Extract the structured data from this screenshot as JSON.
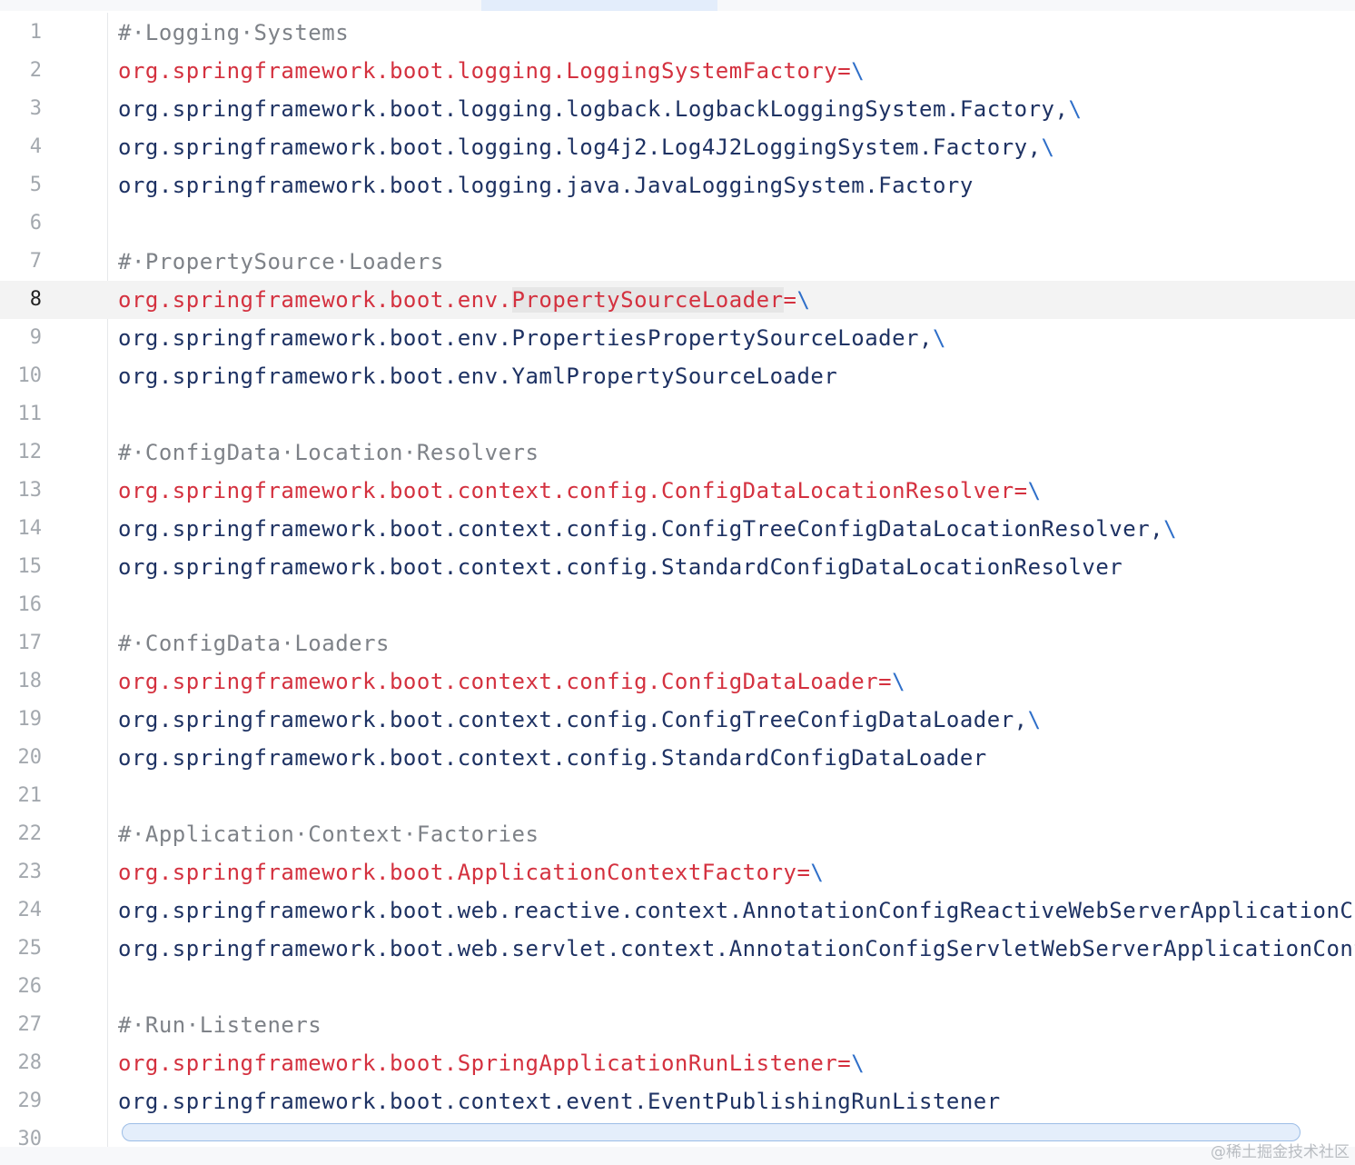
{
  "editor": {
    "current_line": 8,
    "lines": [
      {
        "n": "1",
        "tokens": [
          {
            "t": "#·Logging·Systems",
            "k": "comment"
          }
        ]
      },
      {
        "n": "2",
        "tokens": [
          {
            "t": "org.springframework.boot.logging.LoggingSystemFactory=",
            "k": "key"
          },
          {
            "t": "\\",
            "k": "cont"
          }
        ]
      },
      {
        "n": "3",
        "tokens": [
          {
            "t": "org.springframework.boot.logging.logback.LogbackLoggingSystem.Factory,",
            "k": "plain"
          },
          {
            "t": "\\",
            "k": "cont"
          }
        ]
      },
      {
        "n": "4",
        "tokens": [
          {
            "t": "org.springframework.boot.logging.log4j2.Log4J2LoggingSystem.Factory,",
            "k": "plain"
          },
          {
            "t": "\\",
            "k": "cont"
          }
        ]
      },
      {
        "n": "5",
        "tokens": [
          {
            "t": "org.springframework.boot.logging.java.JavaLoggingSystem.Factory",
            "k": "plain"
          }
        ]
      },
      {
        "n": "6",
        "tokens": []
      },
      {
        "n": "7",
        "tokens": [
          {
            "t": "#·PropertySource·Loaders",
            "k": "comment"
          }
        ]
      },
      {
        "n": "8",
        "tokens": [
          {
            "t": "org.springframework.boot.env.",
            "k": "key"
          },
          {
            "t": "PropertySourceLoader",
            "k": "key",
            "hl": true
          },
          {
            "t": "=",
            "k": "key"
          },
          {
            "t": "\\",
            "k": "cont"
          }
        ]
      },
      {
        "n": "9",
        "tokens": [
          {
            "t": "org.springframework.boot.env.PropertiesPropertySourceLoader,",
            "k": "plain"
          },
          {
            "t": "\\",
            "k": "cont"
          }
        ]
      },
      {
        "n": "10",
        "tokens": [
          {
            "t": "org.springframework.boot.env.YamlPropertySourceLoader",
            "k": "plain"
          }
        ]
      },
      {
        "n": "11",
        "tokens": []
      },
      {
        "n": "12",
        "tokens": [
          {
            "t": "#·ConfigData·Location·Resolvers",
            "k": "comment"
          }
        ]
      },
      {
        "n": "13",
        "tokens": [
          {
            "t": "org.springframework.boot.context.config.ConfigDataLocationResolver=",
            "k": "key"
          },
          {
            "t": "\\",
            "k": "cont"
          }
        ]
      },
      {
        "n": "14",
        "tokens": [
          {
            "t": "org.springframework.boot.context.config.ConfigTreeConfigDataLocationResolver,",
            "k": "plain"
          },
          {
            "t": "\\",
            "k": "cont"
          }
        ]
      },
      {
        "n": "15",
        "tokens": [
          {
            "t": "org.springframework.boot.context.config.StandardConfigDataLocationResolver",
            "k": "plain"
          }
        ]
      },
      {
        "n": "16",
        "tokens": []
      },
      {
        "n": "17",
        "tokens": [
          {
            "t": "#·ConfigData·Loaders",
            "k": "comment"
          }
        ]
      },
      {
        "n": "18",
        "tokens": [
          {
            "t": "org.springframework.boot.context.config.ConfigDataLoader=",
            "k": "key"
          },
          {
            "t": "\\",
            "k": "cont"
          }
        ]
      },
      {
        "n": "19",
        "tokens": [
          {
            "t": "org.springframework.boot.context.config.ConfigTreeConfigDataLoader,",
            "k": "plain"
          },
          {
            "t": "\\",
            "k": "cont"
          }
        ]
      },
      {
        "n": "20",
        "tokens": [
          {
            "t": "org.springframework.boot.context.config.StandardConfigDataLoader",
            "k": "plain"
          }
        ]
      },
      {
        "n": "21",
        "tokens": []
      },
      {
        "n": "22",
        "tokens": [
          {
            "t": "#·Application·Context·Factories",
            "k": "comment"
          }
        ]
      },
      {
        "n": "23",
        "tokens": [
          {
            "t": "org.springframework.boot.ApplicationContextFactory=",
            "k": "key"
          },
          {
            "t": "\\",
            "k": "cont"
          }
        ]
      },
      {
        "n": "24",
        "tokens": [
          {
            "t": "org.springframework.boot.web.reactive.context.AnnotationConfigReactiveWebServerApplicationContext",
            "k": "plain"
          }
        ]
      },
      {
        "n": "25",
        "tokens": [
          {
            "t": "org.springframework.boot.web.servlet.context.AnnotationConfigServletWebServerApplicationContext.Fa",
            "k": "plain"
          }
        ]
      },
      {
        "n": "26",
        "tokens": []
      },
      {
        "n": "27",
        "tokens": [
          {
            "t": "#·Run·Listeners",
            "k": "comment"
          }
        ]
      },
      {
        "n": "28",
        "tokens": [
          {
            "t": "org.springframework.boot.SpringApplicationRunListener=",
            "k": "key"
          },
          {
            "t": "\\",
            "k": "cont"
          }
        ]
      },
      {
        "n": "29",
        "tokens": [
          {
            "t": "org.springframework.boot.context.event.EventPublishingRunListener",
            "k": "plain"
          }
        ]
      },
      {
        "n": "30",
        "tokens": []
      }
    ]
  },
  "watermark": "@稀土掘金技术社区"
}
